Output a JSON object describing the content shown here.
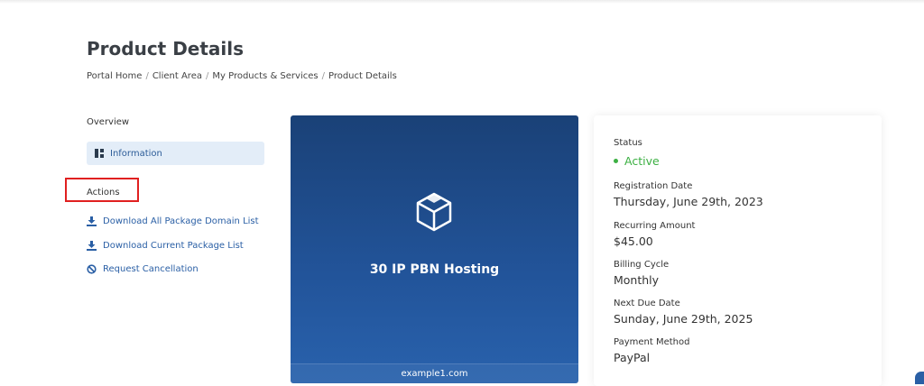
{
  "page": {
    "title": "Product Details"
  },
  "breadcrumb": [
    "Portal Home",
    "Client Area",
    "My Products & Services",
    "Product Details"
  ],
  "sidebar": {
    "overview_heading": "Overview",
    "information_label": "Information",
    "actions_heading": "Actions",
    "actions": [
      {
        "label": "Download All Package Domain List",
        "icon": "download-icon"
      },
      {
        "label": "Download Current Package List",
        "icon": "download-icon"
      },
      {
        "label": "Request Cancellation",
        "icon": "ban-icon"
      }
    ]
  },
  "product": {
    "name": "30 IP PBN Hosting",
    "domain": "example1.com",
    "icon": "box-icon"
  },
  "details": {
    "status_label": "Status",
    "status_value": "Active",
    "registration_label": "Registration Date",
    "registration_value": "Thursday, June 29th, 2023",
    "recurring_label": "Recurring Amount",
    "recurring_value": "$45.00",
    "billing_label": "Billing Cycle",
    "billing_value": "Monthly",
    "next_due_label": "Next Due Date",
    "next_due_value": "Sunday, June 29th, 2025",
    "payment_label": "Payment Method",
    "payment_value": "PayPal"
  },
  "colors": {
    "accent": "#2a5fa5",
    "status_active": "#3cb043",
    "highlight_box": "#e02020"
  }
}
